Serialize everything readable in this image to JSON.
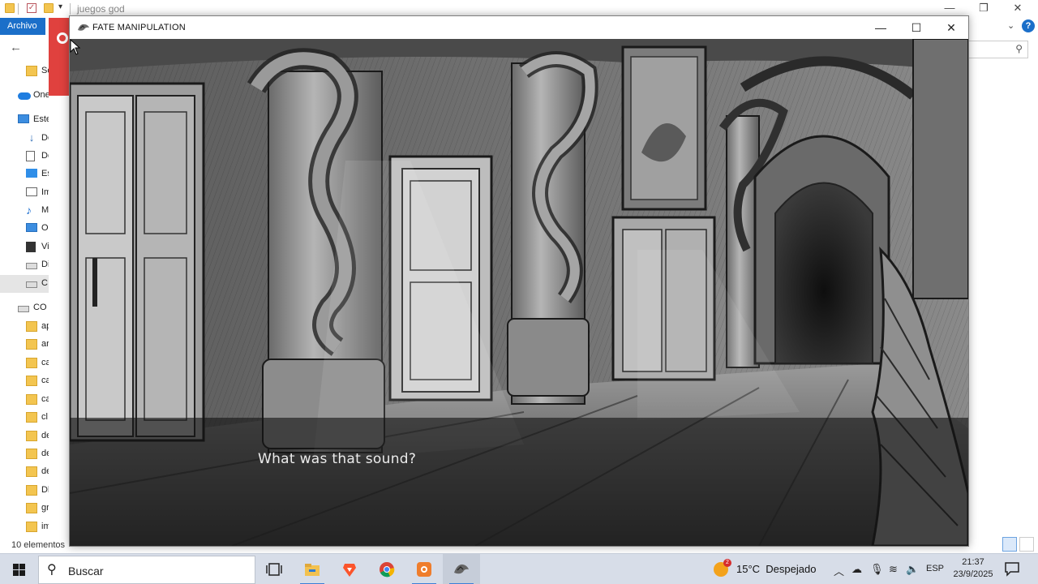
{
  "explorer": {
    "title_path": "juegos god",
    "ribbon_file": "Archivo",
    "status": "10 elementos",
    "sidebar": [
      {
        "label": "Sc",
        "icon": "folder-icon"
      },
      {
        "label": "One",
        "icon": "onedrive-icon"
      },
      {
        "label": "Este",
        "icon": "this-pc-icon"
      },
      {
        "label": "De",
        "icon": "downloads-icon"
      },
      {
        "label": "Do",
        "icon": "documents-icon"
      },
      {
        "label": "Es",
        "icon": "desktop-icon"
      },
      {
        "label": "Im",
        "icon": "pictures-icon"
      },
      {
        "label": "M",
        "icon": "music-icon"
      },
      {
        "label": "O",
        "icon": "objects-3d-icon"
      },
      {
        "label": "Vi",
        "icon": "videos-icon"
      },
      {
        "label": "Di",
        "icon": "drive-icon"
      },
      {
        "label": "C",
        "icon": "drive-icon"
      },
      {
        "label": "CO",
        "icon": "drive-icon"
      },
      {
        "label": "ap",
        "icon": "folder-icon"
      },
      {
        "label": "ar",
        "icon": "folder-icon"
      },
      {
        "label": "ca",
        "icon": "folder-icon"
      },
      {
        "label": "ca",
        "icon": "folder-icon"
      },
      {
        "label": "ca",
        "icon": "folder-icon"
      },
      {
        "label": "cl",
        "icon": "folder-icon"
      },
      {
        "label": "de",
        "icon": "folder-icon"
      },
      {
        "label": "de",
        "icon": "folder-icon"
      },
      {
        "label": "de",
        "icon": "folder-icon"
      },
      {
        "label": "Dl",
        "icon": "folder-icon"
      },
      {
        "label": "gr",
        "icon": "folder-icon"
      },
      {
        "label": "imagen",
        "icon": "folder-icon"
      }
    ]
  },
  "game": {
    "window_title": "FATE MANIPULATION",
    "dialogue": "What was that sound?"
  },
  "taskbar": {
    "search_placeholder": "Buscar",
    "weather_badge": "2",
    "temperature": "15°C",
    "weather": "Despejado",
    "language": "ESP",
    "time": "21:37",
    "date": "23/9/2025"
  },
  "colors": {
    "explorer_accent": "#1b6fc9",
    "taskbar_bg": "#d7dde8",
    "dialogue_text": "#ebebeb"
  }
}
